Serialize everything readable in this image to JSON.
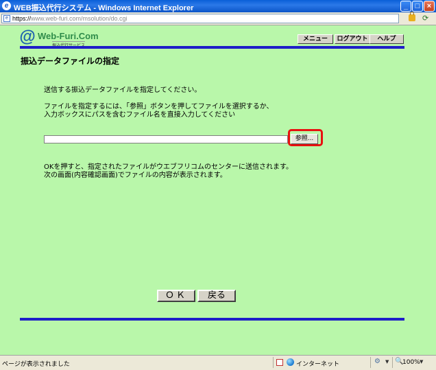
{
  "window": {
    "title": "WEB振込代行システム - Windows Internet Explorer",
    "minimize": "_",
    "maximize": "□",
    "close": "×"
  },
  "address": {
    "url_host": "https://",
    "url_domain": "www.web-furi.com",
    "url_path": "/msolution/do.cgi"
  },
  "logo": {
    "at": "@",
    "brand": "Web-Furi.Com",
    "tagline": "振込代行サービス"
  },
  "nav": {
    "menu": "メニュー",
    "logout": "ログアウト",
    "help": "ヘルプ"
  },
  "page": {
    "title": "振込データファイルの指定",
    "instruction": "送信する振込データファイルを指定してください。",
    "help_line1": "ファイルを指定するには、「参照」ボタンを押してファイルを選択するか、",
    "help_line2": "入力ボックスにパスを含むファイル名を直接入力してください",
    "file_value": "",
    "browse": "参照...",
    "note_line1": "OKを押すと、指定されたファイルがウエブフリコムのセンターに送信されます。",
    "note_line2": "次の画面(内容確認画面)でファイルの内容が表示されます。",
    "ok": "ＯＫ",
    "back": "戻る"
  },
  "status": {
    "text": "ページが表示されました",
    "zone": "インターネット",
    "zoom": "100%"
  },
  "colors": {
    "content_bg": "#b9f7aa",
    "rule": "#1e1ec8",
    "highlight": "#e81010"
  }
}
